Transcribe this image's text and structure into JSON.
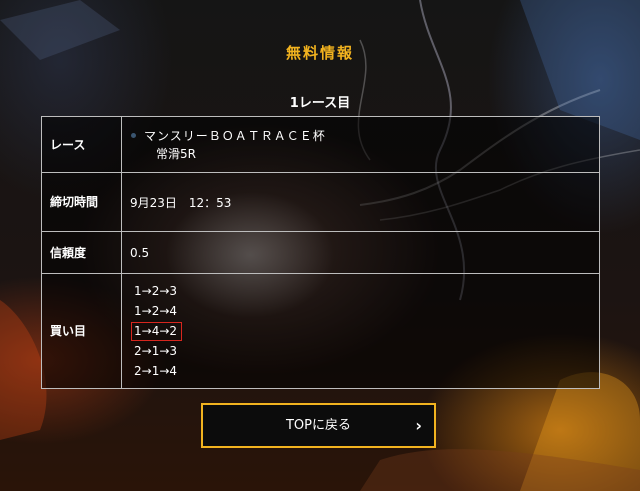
{
  "heading": "無料情報",
  "race_title": "1レース目",
  "rows": {
    "race": {
      "label": "レース",
      "name": "マンスリーＢＯＡＴＲＡＣＥ杯",
      "venue": "常滑5R"
    },
    "deadline": {
      "label": "締切時間",
      "value": "9月23日　12：53"
    },
    "confidence": {
      "label": "信頼度",
      "value": "0.5"
    },
    "bets": {
      "label": "買い目",
      "combos": [
        "1→2→3",
        "1→2→4",
        "1→4→2",
        "2→1→3",
        "2→1→4"
      ],
      "highlighted": "1→4→2"
    }
  },
  "button": {
    "label": "TOPに戻る",
    "chevron": "›",
    "icon": "chevron-right-icon"
  },
  "colors": {
    "accent": "#f2b31f",
    "highlight_border": "#d8261e",
    "table_border": "#bdbdbd"
  }
}
